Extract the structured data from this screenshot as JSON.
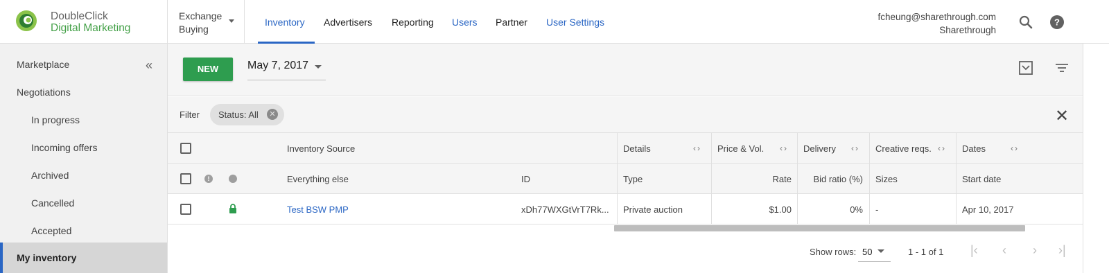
{
  "header": {
    "brand_line1": "DoubleClick",
    "brand_line2": "Digital Marketing",
    "exchange_line1": "Exchange",
    "exchange_line2": "Buying",
    "nav": [
      "Inventory",
      "Advertisers",
      "Reporting",
      "Users",
      "Partner",
      "User Settings"
    ],
    "account_email": "fcheung@sharethrough.com",
    "account_org": "Sharethrough",
    "icons": [
      "search-icon",
      "help-icon"
    ]
  },
  "sidebar": {
    "items": [
      "Marketplace",
      "Negotiations",
      "In progress",
      "Incoming offers",
      "Archived",
      "Cancelled",
      "Accepted",
      "My inventory"
    ],
    "collapse_glyph": "«"
  },
  "toolbar": {
    "new_label": "NEW",
    "date_value": "May 7, 2017"
  },
  "filter": {
    "label": "Filter",
    "chip": "Status: All"
  },
  "table": {
    "group_headers": {
      "inventory_source": "Inventory Source",
      "details": "Details",
      "price": "Price & Vol.",
      "delivery": "Delivery",
      "creative": "Creative reqs.",
      "dates": "Dates"
    },
    "columns": {
      "name": "Everything else",
      "id": "ID",
      "type": "Type",
      "rate": "Rate",
      "bid_ratio": "Bid ratio (%)",
      "sizes": "Sizes",
      "start_date": "Start date"
    },
    "rows": [
      {
        "name": "Test BSW PMP",
        "id": "xDh77WXGtVrT7Rk...",
        "type": "Private auction",
        "rate": "$1.00",
        "bid_ratio": "0%",
        "sizes": "-",
        "start_date": "Apr 10, 2017"
      }
    ]
  },
  "footer": {
    "show_rows_label": "Show rows:",
    "rows_value": "50",
    "range": "1 - 1 of 1"
  },
  "colors": {
    "accent_blue": "#2a66c4",
    "brand_green": "#43a047",
    "button_green": "#2e9d4f"
  }
}
